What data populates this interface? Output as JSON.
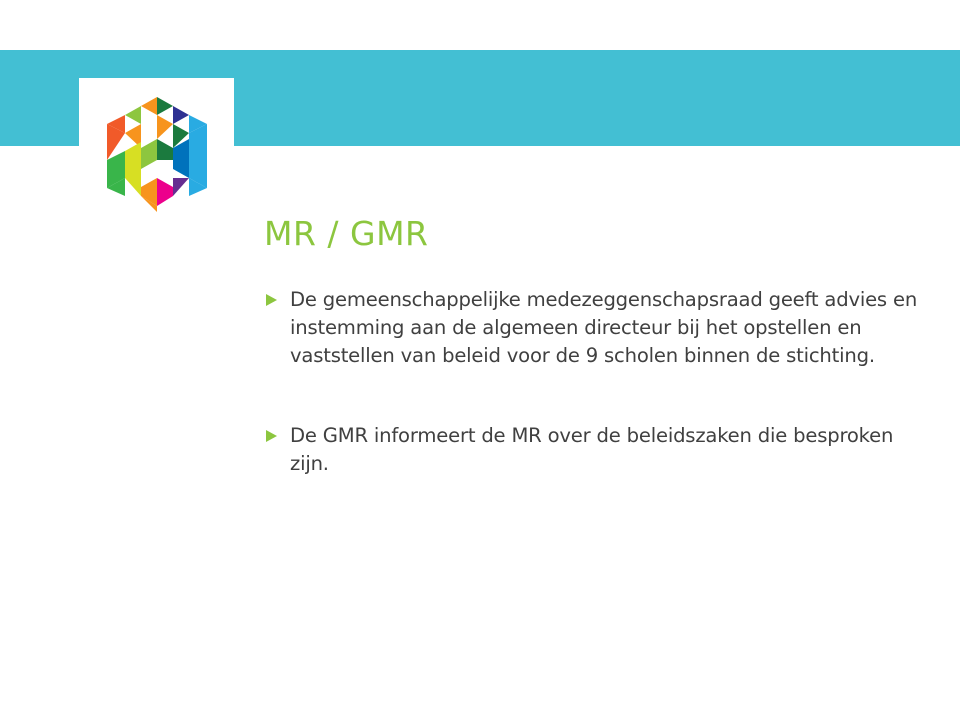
{
  "slide": {
    "title": "MR / GMR",
    "bullets": [
      {
        "text": "De gemeenschappelijke medezeggenschapsraad geeft advies en instemming aan de algemeen directeur bij het opstellen en vaststellen van beleid voor de 9 scholen binnen de stichting."
      },
      {
        "text": "De GMR informeert de MR over de beleidszaken die besproken zijn."
      }
    ]
  },
  "colors": {
    "band": "#43bfd3",
    "title": "#8cc63f",
    "bullet_marker": "#8cc63f",
    "body_text": "#404040"
  },
  "icons": {
    "logo": "multicolor-hexagon-logo-icon",
    "bullet_marker": "triangle-right-icon"
  }
}
